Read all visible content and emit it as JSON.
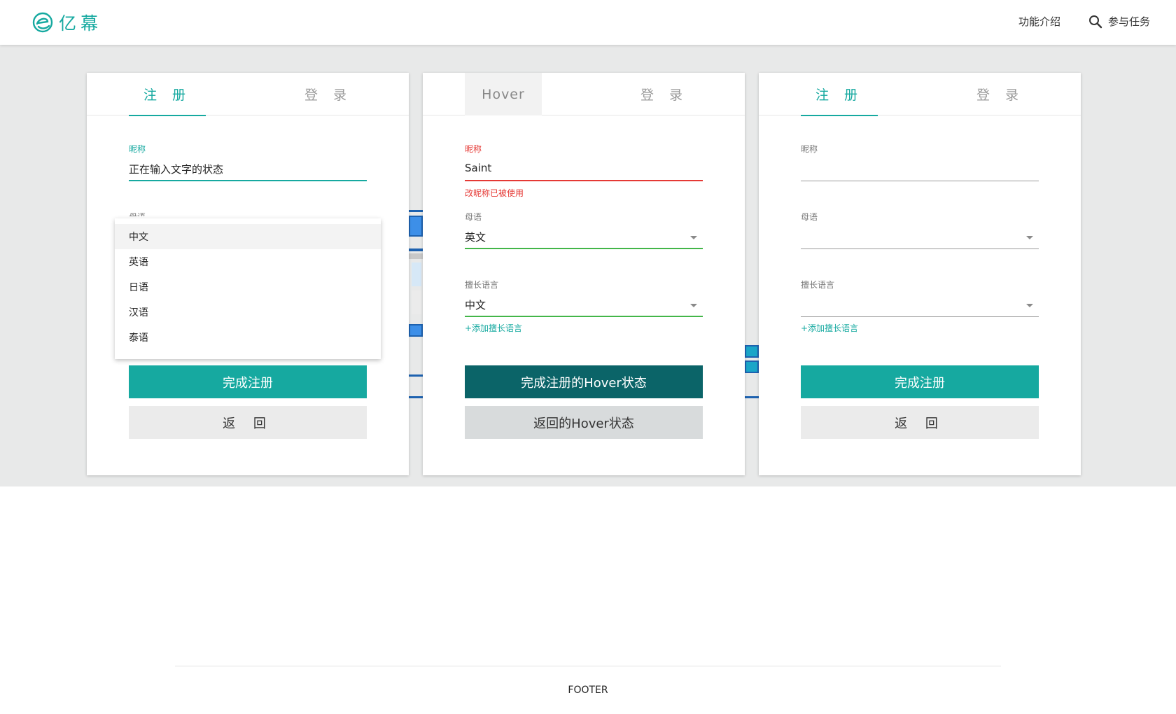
{
  "header": {
    "brand": "亿幕",
    "nav_features": "功能介绍",
    "nav_task": "参与任务"
  },
  "colors": {
    "accent": "#16a9a0",
    "error": "#e53935",
    "valid": "#43b649",
    "primary_hover": "#0b6468"
  },
  "cards": [
    {
      "tab_register": "注 册",
      "tab_login": "登 录",
      "nickname_label": "昵称",
      "nickname_value": "正在输入文字的状态",
      "native_label_partial": "母语",
      "dropdown_options": [
        "中文",
        "英语",
        "日语",
        "汉语",
        "泰语"
      ],
      "submit_label": "完成注册",
      "back_label": "返 回"
    },
    {
      "tab_register": "Hover",
      "tab_login": "登 录",
      "nickname_label": "昵称",
      "nickname_value": "Saint",
      "nickname_error": "改昵称已被使用",
      "native_label": "母语",
      "native_value": "英文",
      "skill_label": "擅长语言",
      "skill_value": "中文",
      "add_skill": "+添加擅长语言",
      "submit_label": "完成注册的Hover状态",
      "back_label": "返回的Hover状态"
    },
    {
      "tab_register": "注 册",
      "tab_login": "登 录",
      "nickname_label": "昵称",
      "nickname_value": "",
      "native_label": "母语",
      "native_value": "",
      "skill_label": "擅长语言",
      "skill_value": "",
      "add_skill": "+添加擅长语言",
      "submit_label": "完成注册",
      "back_label": "返 回"
    }
  ],
  "footer": {
    "text": "FOOTER"
  }
}
